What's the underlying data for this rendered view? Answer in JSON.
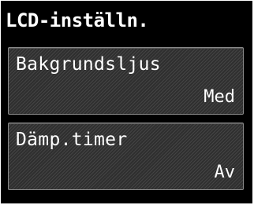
{
  "header": {
    "title": "LCD-inställn."
  },
  "menu": {
    "items": [
      {
        "label": "Bakgrundsljus",
        "value": "Med"
      },
      {
        "label": "Dämp.timer",
        "value": "Av"
      }
    ]
  }
}
